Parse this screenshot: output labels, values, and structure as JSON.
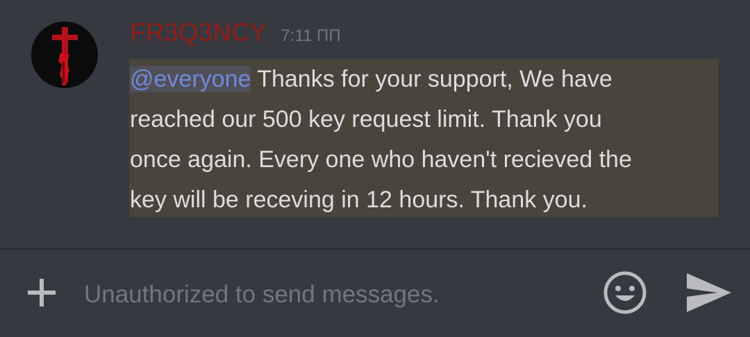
{
  "message": {
    "author": "FR3Q3NCY",
    "timestamp": "7:11 ΠΠ",
    "mention": "@everyone",
    "line1_rest": " Thanks for your support, We have",
    "line2": "reached our 500 key request limit. Thank you",
    "line3": "once again. Every one who haven't recieved the",
    "line4": "key will be receving in 12 hours. Thank you.",
    "avatar_icon": "red-cross-icon"
  },
  "composer": {
    "placeholder": "Unauthorized to send messages.",
    "add_icon": "plus-icon",
    "emoji_icon": "smiley-icon",
    "send_icon": "send-arrow-icon"
  },
  "colors": {
    "background": "#36393f",
    "author": "#8f1e1a",
    "mention": "#7289da",
    "highlight": "#49443c",
    "text": "#dcddde",
    "muted": "#72767d"
  }
}
